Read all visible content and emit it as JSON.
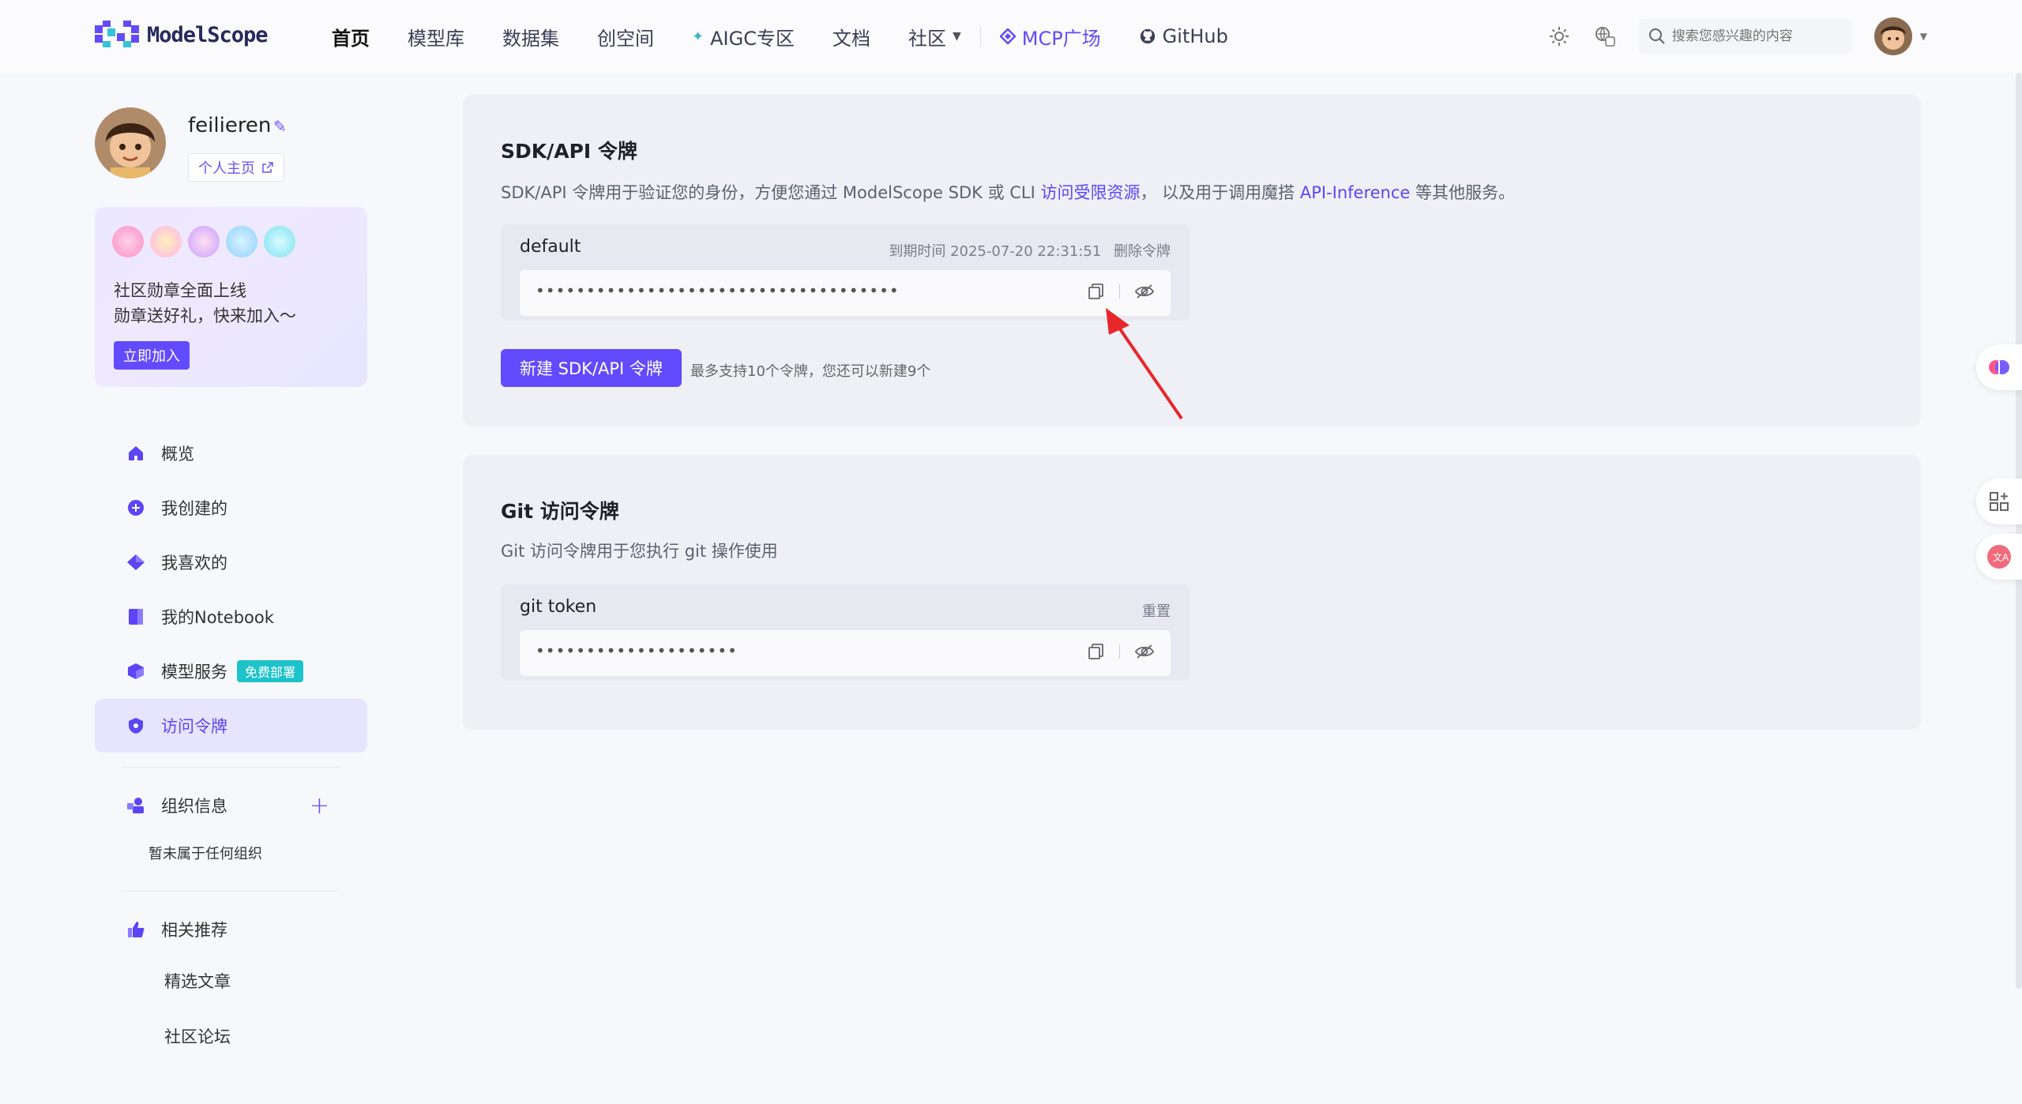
{
  "brand": {
    "name": "ModelScope"
  },
  "nav": {
    "items": [
      {
        "label": "首页",
        "active": true
      },
      {
        "label": "模型库"
      },
      {
        "label": "数据集"
      },
      {
        "label": "创空间"
      },
      {
        "label": "AIGC专区"
      },
      {
        "label": "文档"
      },
      {
        "label": "社区"
      },
      {
        "label": "MCP广场"
      },
      {
        "label": "GitHub"
      }
    ],
    "search_placeholder": "搜索您感兴趣的内容"
  },
  "profile": {
    "username": "feilieren",
    "homepage_label": "个人主页"
  },
  "badge_card": {
    "line1": "社区勋章全面上线",
    "line2": "勋章送好礼，快来加入～",
    "join_label": "立即加入"
  },
  "sidebar": {
    "items": [
      {
        "label": "概览"
      },
      {
        "label": "我创建的"
      },
      {
        "label": "我喜欢的"
      },
      {
        "label": "我的Notebook"
      },
      {
        "label": "模型服务",
        "tag": "免费部署"
      },
      {
        "label": "访问令牌",
        "active": true
      }
    ],
    "org": {
      "label": "组织信息",
      "empty": "暂未属于任何组织"
    },
    "recommend": {
      "label": "相关推荐",
      "items": [
        "精选文章",
        "社区论坛"
      ]
    }
  },
  "sdk_panel": {
    "title": "SDK/API 令牌",
    "desc_prefix": "SDK/API 令牌用于验证您的身份，方便您通过 ModelScope SDK 或 CLI ",
    "desc_link1": "访问受限资源",
    "desc_middle": "，  以及用于调用魔搭 ",
    "desc_link2": "API-Inference",
    "desc_suffix": " 等其他服务。",
    "token": {
      "name": "default",
      "expiry": "到期时间 2025-07-20 22:31:51",
      "delete_label": "删除令牌",
      "masked": "••••••••••••••••••••••••••••••••••••"
    },
    "new_button": "新建 SDK/API 令牌",
    "new_hint": "最多支持10个令牌，您还可以新建9个"
  },
  "git_panel": {
    "title": "Git 访问令牌",
    "desc": "Git 访问令牌用于您执行 git 操作使用",
    "token": {
      "name": "git token",
      "reset_label": "重置",
      "masked": "••••••••••••••••••••"
    }
  },
  "colors": {
    "accent": "#624aff",
    "teal": "#1ec3c9",
    "arrow": "#e8262b"
  }
}
